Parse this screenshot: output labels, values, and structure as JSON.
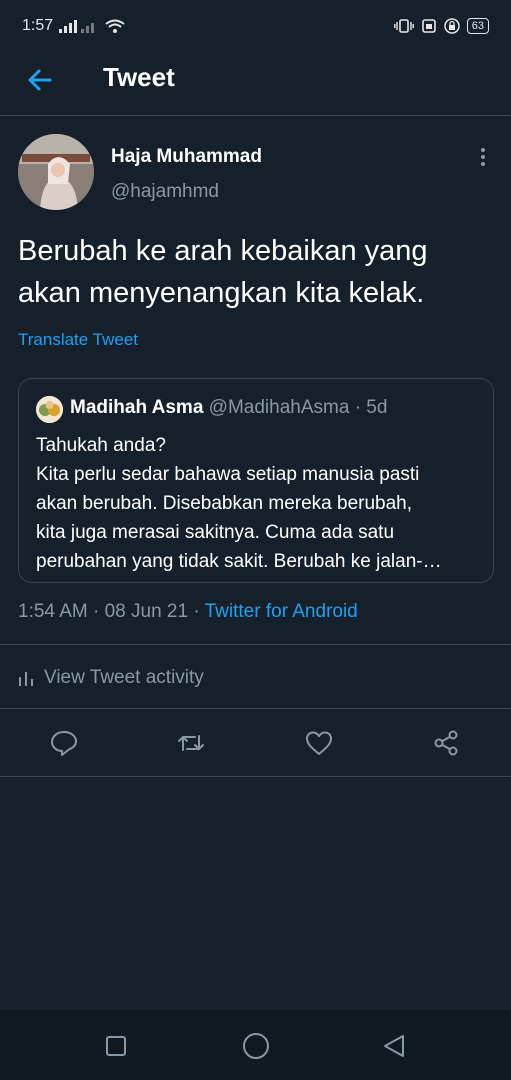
{
  "status_bar": {
    "time": "1:57",
    "signal_icon": "signal-icon",
    "wifi_icon": "wifi-icon",
    "battery": "63"
  },
  "header": {
    "title": "Tweet",
    "back_icon": "back-arrow-icon"
  },
  "tweet": {
    "author_name": "Haja Muhammad",
    "author_handle": "@hajamhmd",
    "text_lines": [
      "Berubah ke arah kebaikan yang",
      "akan menyenangkan kita kelak."
    ],
    "translate_label": "Translate Tweet",
    "time": "1:54 AM",
    "separator": " · ",
    "date": "08 Jun 21",
    "source": "Twitter for Android"
  },
  "quoted_tweet": {
    "author_name": "Madihah Asma",
    "author_handle": "@MadihahAsma",
    "age": "· 5d",
    "lines": [
      "Tahukah anda?",
      "Kita perlu sedar bahawa setiap manusia pasti",
      "akan berubah. Disebabkan mereka berubah,",
      "kita juga merasai sakitnya. Cuma ada satu",
      "perubahan yang tidak sakit. Berubah ke jalan-…"
    ]
  },
  "activity": {
    "label": "View Tweet activity",
    "icon": "bar-chart-icon"
  },
  "actions": [
    "reply-icon",
    "retweet-icon",
    "like-icon",
    "share-icon"
  ],
  "nav": [
    "recent-apps-button",
    "home-button",
    "back-button"
  ],
  "colors": {
    "background": "#15202b",
    "accent": "#1da1f2",
    "secondary_text": "#8899a6",
    "border": "#38444d"
  }
}
